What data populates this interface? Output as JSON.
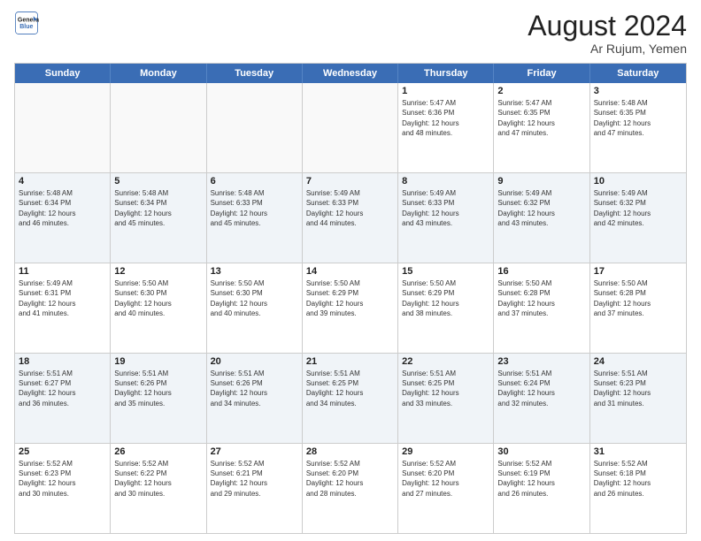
{
  "header": {
    "logo_line1": "General",
    "logo_line2": "Blue",
    "month_year": "August 2024",
    "location": "Ar Rujum, Yemen"
  },
  "days_of_week": [
    "Sunday",
    "Monday",
    "Tuesday",
    "Wednesday",
    "Thursday",
    "Friday",
    "Saturday"
  ],
  "weeks": [
    [
      {
        "day": "",
        "text": ""
      },
      {
        "day": "",
        "text": ""
      },
      {
        "day": "",
        "text": ""
      },
      {
        "day": "",
        "text": ""
      },
      {
        "day": "1",
        "text": "Sunrise: 5:47 AM\nSunset: 6:36 PM\nDaylight: 12 hours\nand 48 minutes."
      },
      {
        "day": "2",
        "text": "Sunrise: 5:47 AM\nSunset: 6:35 PM\nDaylight: 12 hours\nand 47 minutes."
      },
      {
        "day": "3",
        "text": "Sunrise: 5:48 AM\nSunset: 6:35 PM\nDaylight: 12 hours\nand 47 minutes."
      }
    ],
    [
      {
        "day": "4",
        "text": "Sunrise: 5:48 AM\nSunset: 6:34 PM\nDaylight: 12 hours\nand 46 minutes."
      },
      {
        "day": "5",
        "text": "Sunrise: 5:48 AM\nSunset: 6:34 PM\nDaylight: 12 hours\nand 45 minutes."
      },
      {
        "day": "6",
        "text": "Sunrise: 5:48 AM\nSunset: 6:33 PM\nDaylight: 12 hours\nand 45 minutes."
      },
      {
        "day": "7",
        "text": "Sunrise: 5:49 AM\nSunset: 6:33 PM\nDaylight: 12 hours\nand 44 minutes."
      },
      {
        "day": "8",
        "text": "Sunrise: 5:49 AM\nSunset: 6:33 PM\nDaylight: 12 hours\nand 43 minutes."
      },
      {
        "day": "9",
        "text": "Sunrise: 5:49 AM\nSunset: 6:32 PM\nDaylight: 12 hours\nand 43 minutes."
      },
      {
        "day": "10",
        "text": "Sunrise: 5:49 AM\nSunset: 6:32 PM\nDaylight: 12 hours\nand 42 minutes."
      }
    ],
    [
      {
        "day": "11",
        "text": "Sunrise: 5:49 AM\nSunset: 6:31 PM\nDaylight: 12 hours\nand 41 minutes."
      },
      {
        "day": "12",
        "text": "Sunrise: 5:50 AM\nSunset: 6:30 PM\nDaylight: 12 hours\nand 40 minutes."
      },
      {
        "day": "13",
        "text": "Sunrise: 5:50 AM\nSunset: 6:30 PM\nDaylight: 12 hours\nand 40 minutes."
      },
      {
        "day": "14",
        "text": "Sunrise: 5:50 AM\nSunset: 6:29 PM\nDaylight: 12 hours\nand 39 minutes."
      },
      {
        "day": "15",
        "text": "Sunrise: 5:50 AM\nSunset: 6:29 PM\nDaylight: 12 hours\nand 38 minutes."
      },
      {
        "day": "16",
        "text": "Sunrise: 5:50 AM\nSunset: 6:28 PM\nDaylight: 12 hours\nand 37 minutes."
      },
      {
        "day": "17",
        "text": "Sunrise: 5:50 AM\nSunset: 6:28 PM\nDaylight: 12 hours\nand 37 minutes."
      }
    ],
    [
      {
        "day": "18",
        "text": "Sunrise: 5:51 AM\nSunset: 6:27 PM\nDaylight: 12 hours\nand 36 minutes."
      },
      {
        "day": "19",
        "text": "Sunrise: 5:51 AM\nSunset: 6:26 PM\nDaylight: 12 hours\nand 35 minutes."
      },
      {
        "day": "20",
        "text": "Sunrise: 5:51 AM\nSunset: 6:26 PM\nDaylight: 12 hours\nand 34 minutes."
      },
      {
        "day": "21",
        "text": "Sunrise: 5:51 AM\nSunset: 6:25 PM\nDaylight: 12 hours\nand 34 minutes."
      },
      {
        "day": "22",
        "text": "Sunrise: 5:51 AM\nSunset: 6:25 PM\nDaylight: 12 hours\nand 33 minutes."
      },
      {
        "day": "23",
        "text": "Sunrise: 5:51 AM\nSunset: 6:24 PM\nDaylight: 12 hours\nand 32 minutes."
      },
      {
        "day": "24",
        "text": "Sunrise: 5:51 AM\nSunset: 6:23 PM\nDaylight: 12 hours\nand 31 minutes."
      }
    ],
    [
      {
        "day": "25",
        "text": "Sunrise: 5:52 AM\nSunset: 6:23 PM\nDaylight: 12 hours\nand 30 minutes."
      },
      {
        "day": "26",
        "text": "Sunrise: 5:52 AM\nSunset: 6:22 PM\nDaylight: 12 hours\nand 30 minutes."
      },
      {
        "day": "27",
        "text": "Sunrise: 5:52 AM\nSunset: 6:21 PM\nDaylight: 12 hours\nand 29 minutes."
      },
      {
        "day": "28",
        "text": "Sunrise: 5:52 AM\nSunset: 6:20 PM\nDaylight: 12 hours\nand 28 minutes."
      },
      {
        "day": "29",
        "text": "Sunrise: 5:52 AM\nSunset: 6:20 PM\nDaylight: 12 hours\nand 27 minutes."
      },
      {
        "day": "30",
        "text": "Sunrise: 5:52 AM\nSunset: 6:19 PM\nDaylight: 12 hours\nand 26 minutes."
      },
      {
        "day": "31",
        "text": "Sunrise: 5:52 AM\nSunset: 6:18 PM\nDaylight: 12 hours\nand 26 minutes."
      }
    ]
  ]
}
